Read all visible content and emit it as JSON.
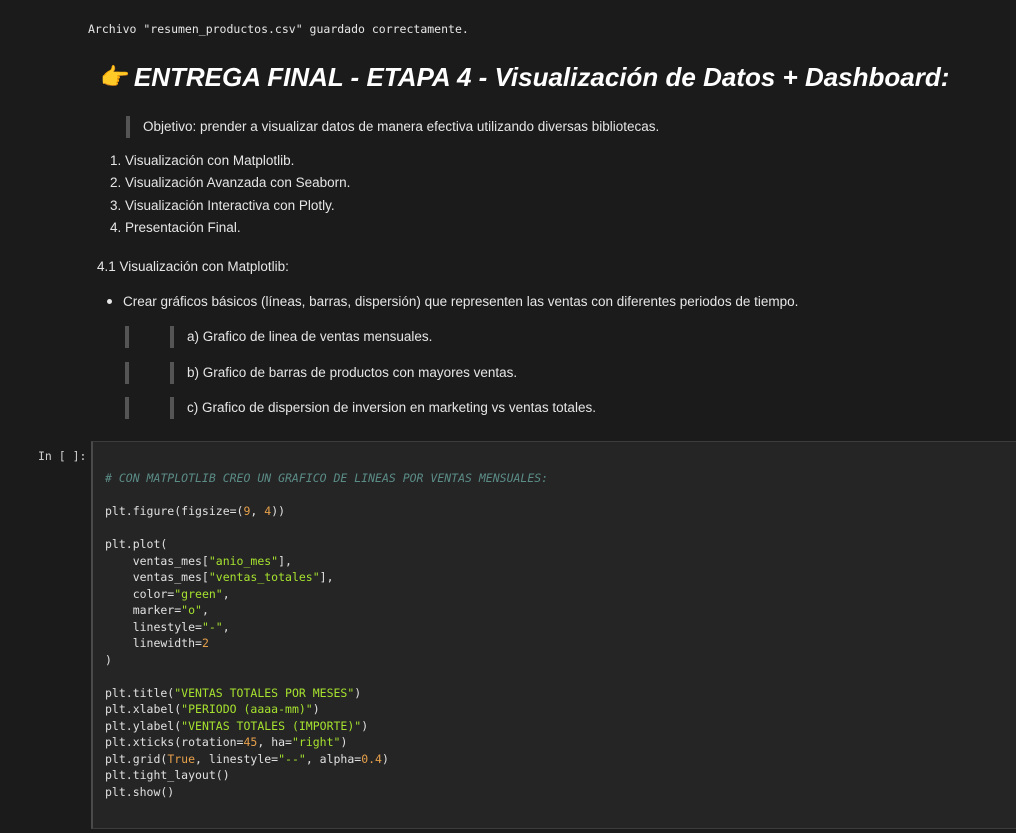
{
  "output": {
    "text": "Archivo \"resumen_productos.csv\" guardado correctamente."
  },
  "markdown": {
    "heading_emoji": "👉",
    "heading": "ENTREGA FINAL - ETAPA 4 - Visualización de Datos + Dashboard:",
    "objective": "Objetivo: prender a visualizar datos de manera efectiva utilizando diversas bibliotecas.",
    "steps": [
      "1. Visualización con Matplotlib.",
      "2. Visualización Avanzada con Seaborn.",
      "3. Visualización Interactiva con Plotly.",
      "4. Presentación Final."
    ],
    "subheading": "4.1 Visualización con Matplotlib:",
    "bullet": "Crear gráficos básicos (líneas, barras, dispersión) que representen las ventas con diferentes periodos de tiempo.",
    "nested": [
      "a) Grafico de linea de ventas mensuales.",
      "b) Grafico de barras de productos con mayores ventas.",
      "c) Grafico de dispersion de inversion en marketing vs ventas totales."
    ]
  },
  "code_cell": {
    "prompt": "In [ ]:",
    "comment": "# CON MATPLOTLIB CREO UN GRAFICO DE LINEAS POR VENTAS MENSUALES:",
    "figure_call": "plt.figure(figsize=(",
    "figsize_w": "9",
    "figsize_sep": ", ",
    "figsize_h": "4",
    "figure_close": "))",
    "plot_open": "plt.plot(",
    "arg1_pre": "    ventas_mes[",
    "arg1_str": "\"anio_mes\"",
    "arg1_post": "],",
    "arg2_pre": "    ventas_mes[",
    "arg2_str": "\"ventas_totales\"",
    "arg2_post": "],",
    "color_pre": "    color=",
    "color_str": "\"green\"",
    "color_post": ",",
    "marker_pre": "    marker=",
    "marker_str": "\"o\"",
    "marker_post": ",",
    "ls_pre": "    linestyle=",
    "ls_str": "\"-\"",
    "ls_post": ",",
    "lw_pre": "    linewidth=",
    "lw_num": "2",
    "plot_close": ")",
    "title_pre": "plt.title(",
    "title_str": "\"VENTAS TOTALES POR MESES\"",
    "title_post": ")",
    "xlabel_pre": "plt.xlabel(",
    "xlabel_str": "\"PERIODO (aaaa-mm)\"",
    "xlabel_post": ")",
    "ylabel_pre": "plt.ylabel(",
    "ylabel_str": "\"VENTAS TOTALES (IMPORTE)\"",
    "ylabel_post": ")",
    "xticks_pre": "plt.xticks(rotation=",
    "xticks_num": "45",
    "xticks_mid": ", ha=",
    "xticks_str": "\"right\"",
    "xticks_post": ")",
    "grid_pre": "plt.grid(",
    "grid_kw": "True",
    "grid_mid": ", linestyle=",
    "grid_str": "\"--\"",
    "grid_mid2": ", alpha=",
    "grid_num": "0.4",
    "grid_post": ")",
    "tight": "plt.tight_layout()",
    "show": "plt.show()"
  }
}
